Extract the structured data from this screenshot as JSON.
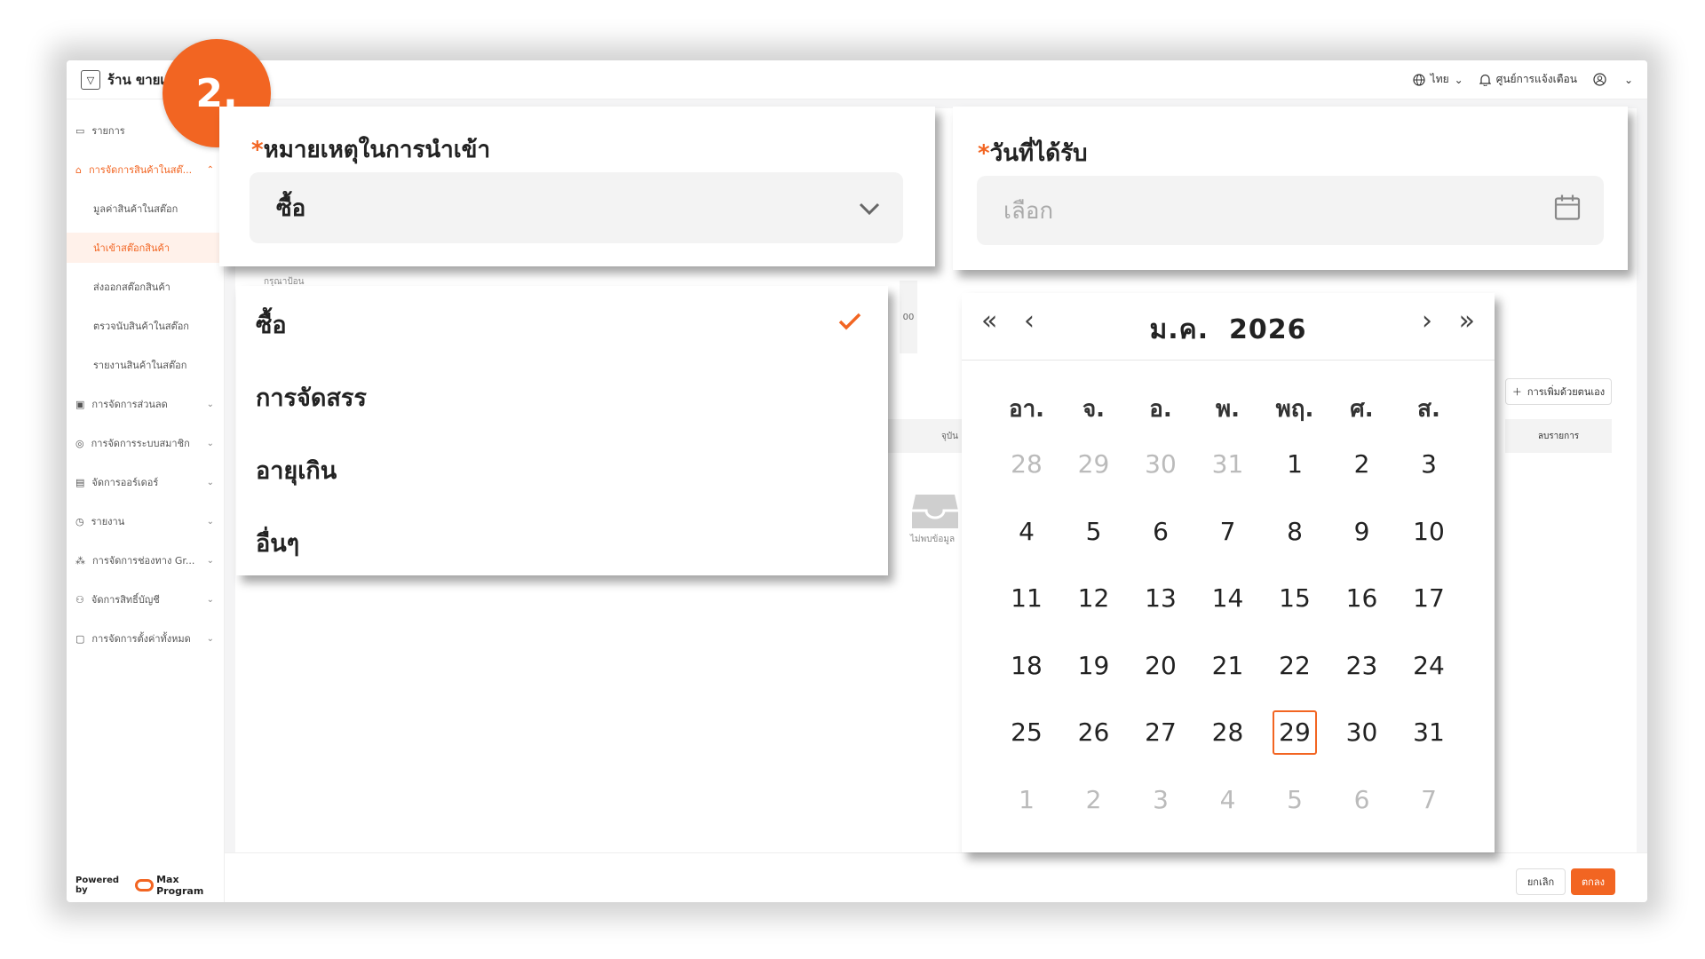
{
  "app": {
    "store_name": "ร้าน ขายเสื้",
    "language": "ไทย",
    "notification_center": "ศูนย์การแจ้งเตือน",
    "powered_by": "Powered by",
    "brand_product": "Max Program"
  },
  "sidebar": {
    "items": [
      {
        "label": "รายการ",
        "icon": "list-icon"
      },
      {
        "label": "การจัดการสินค้าในสต๊...",
        "icon": "warehouse-icon"
      },
      {
        "label": "มูลค่าสินค้าในสต๊อก"
      },
      {
        "label": "นำเข้าสต๊อกสินค้า"
      },
      {
        "label": "ส่งออกสต๊อกสินค้า"
      },
      {
        "label": "ตรวจนับสินค้าในสต๊อก"
      },
      {
        "label": "รายงานสินค้าในสต๊อก"
      },
      {
        "label": "การจัดการส่วนลด",
        "icon": "tag-icon"
      },
      {
        "label": "การจัดการระบบสมาชิก",
        "icon": "member-icon"
      },
      {
        "label": "จัดการออร์เดอร์",
        "icon": "order-icon"
      },
      {
        "label": "รายงาน",
        "icon": "report-icon"
      },
      {
        "label": "การจัดการช่องทาง Gr...",
        "icon": "channel-icon"
      },
      {
        "label": "จัดการสิทธิ์บัญชี",
        "icon": "account-icon"
      },
      {
        "label": "การจัดการตั้งค่าทั้งหมด",
        "icon": "settings-icon"
      }
    ]
  },
  "step_badge": "2.",
  "background": {
    "manual_add_button": "การเพิ่มด้วยตนเอง",
    "delete_items": "ลบรายการ",
    "current_col": "จุบัน",
    "no_data": "ไม่พบข้อมูล",
    "cancel_button": "ยกเลิก",
    "confirm_button": "ตกลง",
    "hint": "กรุณาป้อน",
    "partial_number": "00"
  },
  "reason_field": {
    "required_mark": "*",
    "label": "หมายเหตุในการนำเข้า",
    "value": "ซื้อ",
    "options": [
      "ซื้อ",
      "การจัดสรร",
      "อายุเกิน",
      "อื่นๆ"
    ],
    "selected_index": 0
  },
  "date_field": {
    "required_mark": "*",
    "label": "วันที่ได้รับ",
    "placeholder": "เลือก"
  },
  "calendar": {
    "month": "ม.ค.",
    "year": "2026",
    "weekdays": [
      "อา.",
      "จ.",
      "อ.",
      "พ.",
      "พฤ.",
      "ศ.",
      "ส."
    ],
    "weeks": [
      [
        "28",
        "29",
        "30",
        "31",
        "1",
        "2",
        "3"
      ],
      [
        "4",
        "5",
        "6",
        "7",
        "8",
        "9",
        "10"
      ],
      [
        "11",
        "12",
        "13",
        "14",
        "15",
        "16",
        "17"
      ],
      [
        "18",
        "19",
        "20",
        "21",
        "22",
        "23",
        "24"
      ],
      [
        "25",
        "26",
        "27",
        "28",
        "29",
        "30",
        "31"
      ],
      [
        "1",
        "2",
        "3",
        "4",
        "5",
        "6",
        "7"
      ]
    ],
    "muted_first_row_count": 4,
    "muted_last_row": true,
    "today": "29",
    "accent_color": "#f26522"
  }
}
